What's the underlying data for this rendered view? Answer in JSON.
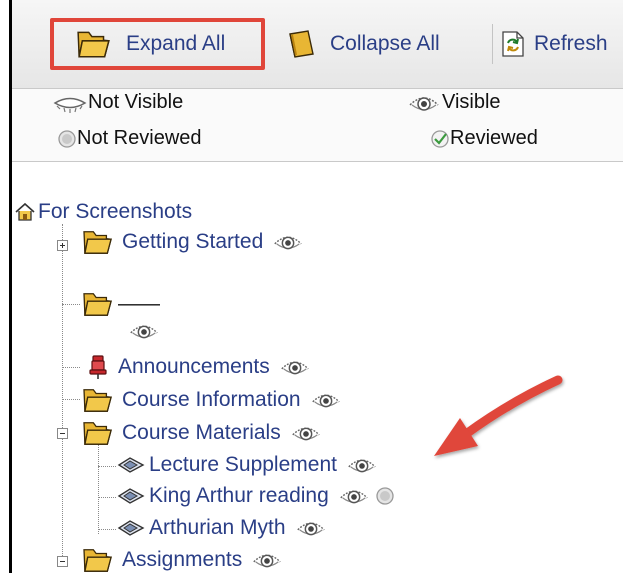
{
  "toolbar": {
    "expand_label": "Expand All",
    "collapse_label": "Collapse All",
    "refresh_label": "Refresh"
  },
  "legend": {
    "not_visible": "Not Visible",
    "visible": "Visible",
    "not_reviewed": "Not Reviewed",
    "reviewed": "Reviewed"
  },
  "tree": {
    "root": "For Screenshots",
    "items": [
      {
        "label": "Getting Started",
        "icon": "folder-icon"
      },
      {
        "label": "——",
        "icon": "folder-icon"
      },
      {
        "label": "Announcements",
        "icon": "pushpin-icon"
      },
      {
        "label": "Course Information",
        "icon": "folder-icon"
      },
      {
        "label": "Course Materials",
        "icon": "folder-icon"
      },
      {
        "label": "Lecture Supplement",
        "icon": "item-icon"
      },
      {
        "label": "King Arthur reading",
        "icon": "item-icon"
      },
      {
        "label": "Arthurian Myth",
        "icon": "item-icon"
      },
      {
        "label": "Assignments",
        "icon": "folder-icon"
      }
    ]
  },
  "colors": {
    "link": "#2a3e86",
    "highlight": "#e0463a",
    "folder": "#d9a21a"
  }
}
